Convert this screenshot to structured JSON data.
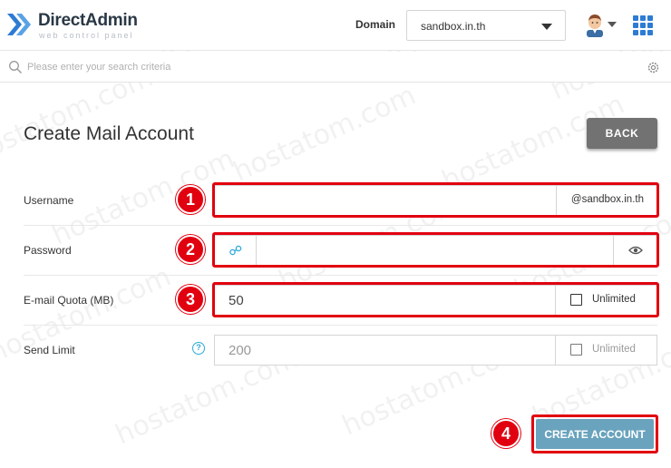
{
  "header": {
    "logo_text": "DirectAdmin",
    "logo_subtitle": "web control panel",
    "domain_label": "Domain",
    "domain_value": "sandbox.in.th"
  },
  "search": {
    "placeholder": "Please enter your search criteria"
  },
  "page": {
    "title": "Create Mail Account",
    "back_label": "BACK",
    "create_label": "CREATE ACCOUNT"
  },
  "form": {
    "username": {
      "label": "Username",
      "value": "",
      "suffix": "@sandbox.in.th"
    },
    "password": {
      "label": "Password",
      "value": ""
    },
    "quota": {
      "label": "E-mail Quota (MB)",
      "value": "50",
      "unlimited_label": "Unlimited",
      "unlimited_checked": false
    },
    "send_limit": {
      "label": "Send Limit",
      "placeholder": "200",
      "unlimited_label": "Unlimited",
      "unlimited_checked": false,
      "help_symbol": "?"
    }
  },
  "steps": [
    "1",
    "2",
    "3",
    "4"
  ],
  "watermark_text": "hostatom.com",
  "colors": {
    "accent_red": "#e1000f",
    "button_gray": "#727272",
    "create_button": "#6aa3bd",
    "icon_blue": "#2e7bd4",
    "help_blue": "#29a9d9"
  }
}
